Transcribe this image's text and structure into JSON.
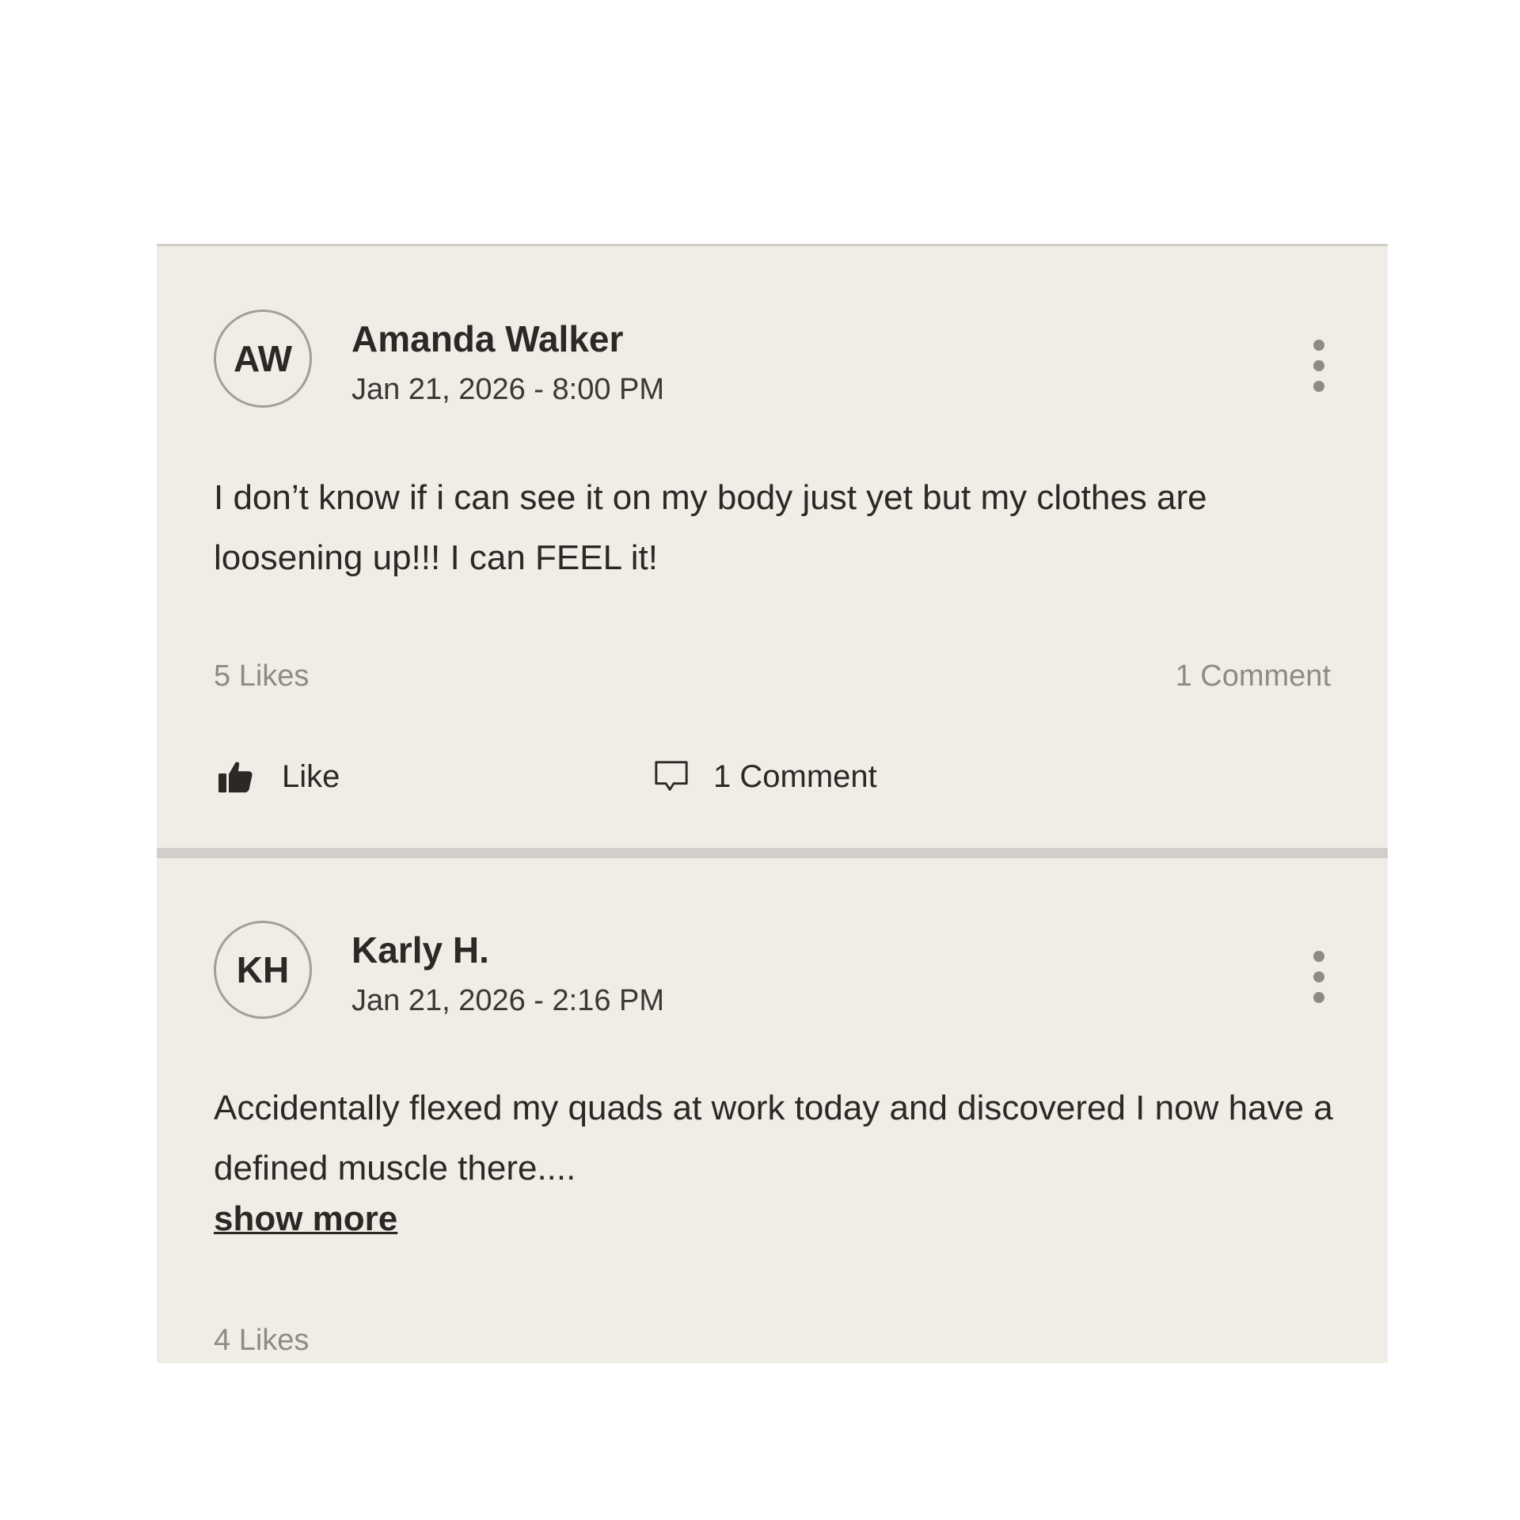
{
  "posts": [
    {
      "initials": "AW",
      "author": "Amanda Walker",
      "timestamp": "Jan 21, 2026 - 8:00 PM",
      "text": "I don’t know if i can see it on my body just yet but my clothes are loosening up!!! I can FEEL it!",
      "likes_label": "5 Likes",
      "comments_label": "1 Comment",
      "like_action_label": "Like",
      "comment_action_label": "1 Comment",
      "more_icon": "more-vertical-icon",
      "like_icon": "thumbs-up-icon",
      "comment_icon": "comment-bubble-icon"
    },
    {
      "initials": "KH",
      "author": "Karly H.",
      "timestamp": "Jan 21, 2026 - 2:16 PM",
      "text": "Accidentally flexed my quads at work today and discovered I now have a defined muscle there....",
      "show_more_label": "show more",
      "likes_label": "4 Likes",
      "more_icon": "more-vertical-icon"
    }
  ],
  "colors": {
    "card_background": "#f0ece6",
    "divider": "#d2cfca",
    "text_primary": "#2b2926",
    "text_muted": "#8e8b87",
    "avatar_border": "#a29f9b"
  }
}
